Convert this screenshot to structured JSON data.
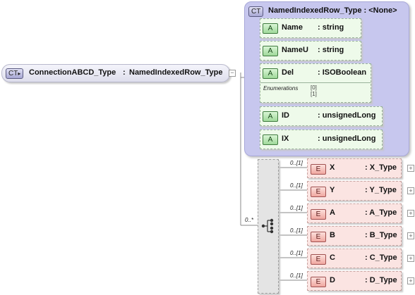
{
  "root": {
    "badge": "CT",
    "name": "ConnectionABCD_Type",
    "separator": ":",
    "type": "NamedIndexedRow_Type"
  },
  "base_type": {
    "badge": "CT",
    "title": "NamedIndexedRow_Type : <None>",
    "attributes": [
      {
        "badge": "A",
        "name": "Name",
        "type": ": string"
      },
      {
        "badge": "A",
        "name": "NameU",
        "type": ": string"
      },
      {
        "badge": "A",
        "name": "Del",
        "type": ": ISOBoolean",
        "enum_label": "Enumerations",
        "enum_values": [
          "[0]",
          "[1]"
        ]
      },
      {
        "badge": "A",
        "name": "ID",
        "type": ": unsignedLong"
      },
      {
        "badge": "A",
        "name": "IX",
        "type": ": unsignedLong"
      }
    ]
  },
  "choice": {
    "occurrence": "0..*",
    "icon": "choice-compositor-icon"
  },
  "elements": [
    {
      "badge": "E",
      "occurrence": "0..[1]",
      "name": "X",
      "type": ": X_Type"
    },
    {
      "badge": "E",
      "occurrence": "0..[1]",
      "name": "Y",
      "type": ": Y_Type"
    },
    {
      "badge": "E",
      "occurrence": "0..[1]",
      "name": "A",
      "type": ": A_Type"
    },
    {
      "badge": "E",
      "occurrence": "0..[1]",
      "name": "B",
      "type": ": B_Type"
    },
    {
      "badge": "E",
      "occurrence": "0..[1]",
      "name": "C",
      "type": ": C_Type"
    },
    {
      "badge": "E",
      "occurrence": "0..[1]",
      "name": "D",
      "type": ": D_Type"
    }
  ],
  "expand_symbol": "+",
  "collapse_symbol": "−"
}
